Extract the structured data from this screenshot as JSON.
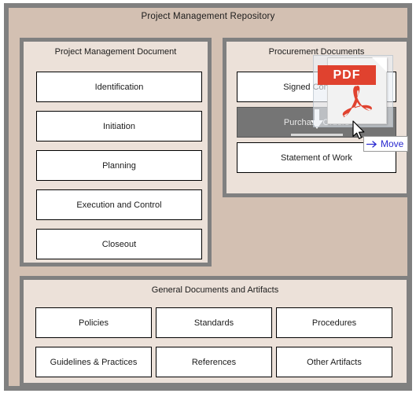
{
  "repository": {
    "title": "Project Management Repository",
    "frame_border_color": "#808080",
    "frame_fill_color": "#d3c0b2",
    "panel_fill_color": "#ece1d9"
  },
  "panels": {
    "project_management_document": {
      "title": "Project Management Document",
      "tiles": [
        {
          "label": "Identification"
        },
        {
          "label": "Initiation"
        },
        {
          "label": "Planning"
        },
        {
          "label": "Execution and Control"
        },
        {
          "label": "Closeout"
        }
      ]
    },
    "procurement_documents": {
      "title": "Procurement Documents",
      "tiles": [
        {
          "label": "Signed Contracts",
          "state": "normal"
        },
        {
          "label": "Purchase Orders",
          "state": "drop-target-highlighted"
        },
        {
          "label": "Statement of Work",
          "state": "normal"
        }
      ],
      "highlight_color": "#757575"
    },
    "general_documents": {
      "title": "General Documents and Artifacts",
      "tiles": [
        {
          "label": "Policies"
        },
        {
          "label": "Standards"
        },
        {
          "label": "Procedures"
        },
        {
          "label": "Guidelines & Practices"
        },
        {
          "label": "References"
        },
        {
          "label": "Other Artifacts"
        }
      ]
    }
  },
  "drag_operation": {
    "dragged_item_icon": "pdf-file-icon",
    "pdf_label": "PDF",
    "pdf_accent_color": "#e0422f",
    "drop_indicator_icon": "down-arrow-drop-indicator",
    "cursor_icon": "arrow-cursor",
    "tooltip": {
      "label": "Move",
      "icon": "move-arrow-icon",
      "text_color": "#2a2ad0"
    }
  }
}
